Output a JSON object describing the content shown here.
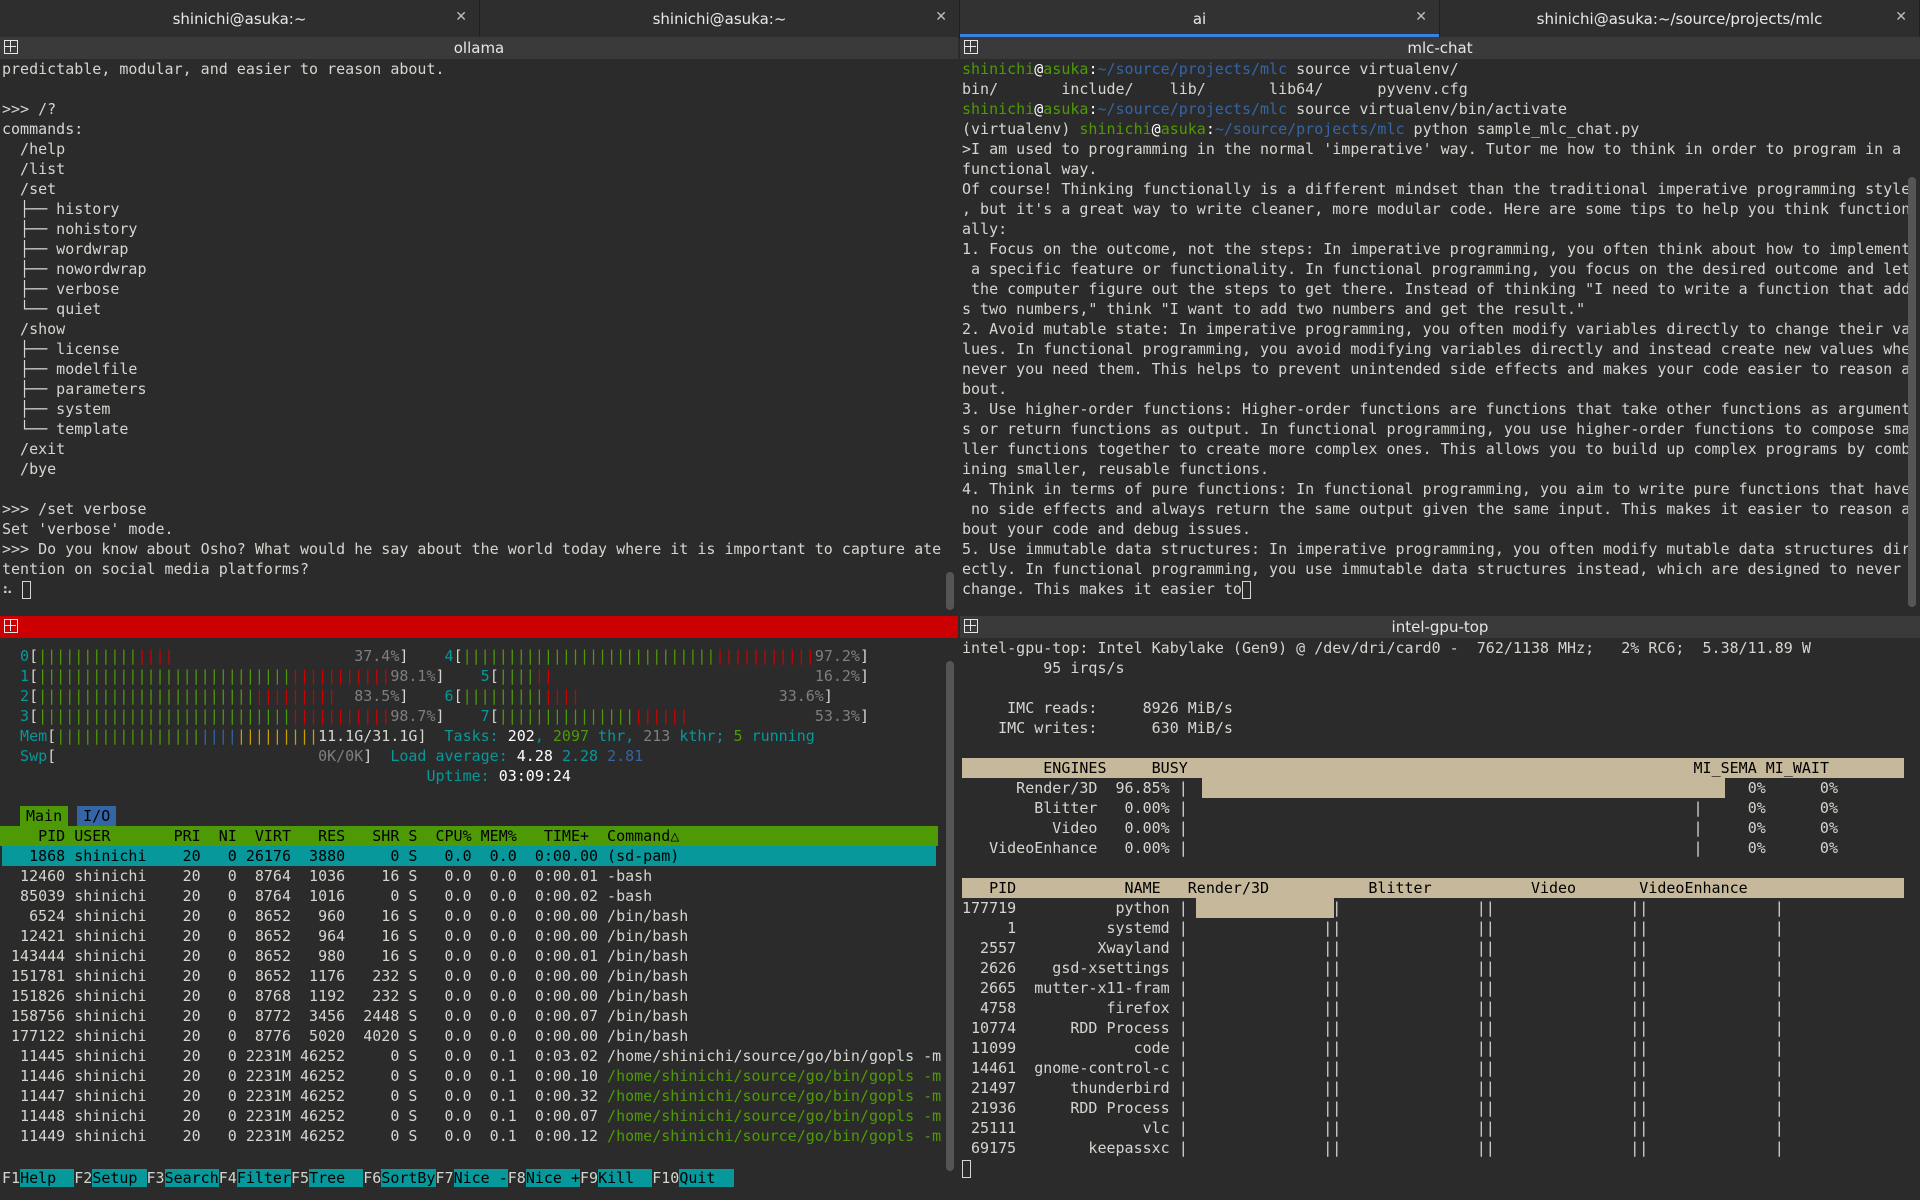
{
  "tabs": [
    {
      "label": "shinichi@asuka:~"
    },
    {
      "label": "shinichi@asuka:~"
    },
    {
      "label": "ai"
    },
    {
      "label": "shinichi@asuka:~/source/projects/mlc"
    }
  ],
  "panes": {
    "ollama": {
      "title": "ollama",
      "lines": [
        "predictable, modular, and easier to reason about.",
        "",
        ">>> /?",
        "commands:",
        "  /help",
        "  /list",
        "  /set",
        "  ├── history",
        "  ├── nohistory",
        "  ├── wordwrap",
        "  ├── nowordwrap",
        "  ├── verbose",
        "  └── quiet",
        "  /show",
        "  ├── license",
        "  ├── modelfile",
        "  ├── parameters",
        "  ├── system",
        "  └── template",
        "  /exit",
        "  /bye",
        "",
        ">>> /set verbose",
        "Set 'verbose' mode.",
        ">>> Do you know about Osho? What would he say about the world today where it is important to capture ate",
        "tention on social media platforms?"
      ],
      "prompt_tail": "⠦ "
    },
    "mlc": {
      "title": "mlc-chat",
      "user": "shinichi",
      "host": "asuka",
      "path": "~/source/projects/mlc",
      "cmd1": " source virtualenv/",
      "ls": "bin/       include/    lib/       lib64/      pyvenv.cfg",
      "cmd2": " source virtualenv/bin/activate",
      "venv": "(virtualenv) ",
      "cmd3": " python sample_mlc_chat.py",
      "lines": [
        ">I am used to programming in the normal 'imperative' way. Tutor me how to think in order to program in a",
        "functional way.",
        "Of course! Thinking functionally is a different mindset than the traditional imperative programming style",
        ", but it's a great way to write cleaner, more modular code. Here are some tips to help you think function",
        "ally:",
        "1. Focus on the outcome, not the steps: In imperative programming, you often think about how to implement",
        " a specific feature or functionality. In functional programming, you focus on the desired outcome and let",
        " the computer figure out the steps to get there. Instead of thinking \"I need to write a function that add",
        "s two numbers,\" think \"I want to add two numbers and get the result.\"",
        "2. Avoid mutable state: In imperative programming, you often modify variables directly to change their va",
        "lues. In functional programming, you avoid modifying variables directly and instead create new values whe",
        "never you need them. This helps to prevent unintended side effects and makes your code easier to reason a",
        "bout.",
        "3. Use higher-order functions: Higher-order functions are functions that take other functions as argument",
        "s or return functions as output. In functional programming, you use higher-order functions to compose sma",
        "ller functions together to create more complex ones. This allows you to build up complex programs by comb",
        "ining smaller, reusable functions.",
        "4. Think in terms of pure functions: In functional programming, you aim to write pure functions that have",
        " no side effects and always return the same output given the same input. This makes it easier to reason a",
        "bout your code and debug issues.",
        "5. Use immutable data structures: In imperative programming, you often modify mutable data structures dir",
        "ectly. In functional programming, you use immutable data structures instead, which are designed to never",
        "change. This makes it easier to"
      ]
    },
    "htop": {
      "title": "htop",
      "cpus": [
        {
          "id": "0",
          "pct": "37.4%",
          "level": 0.374
        },
        {
          "id": "1",
          "pct": "98.1%",
          "level": 0.981
        },
        {
          "id": "2",
          "pct": "83.5%",
          "level": 0.835
        },
        {
          "id": "3",
          "pct": "98.7%",
          "level": 0.987
        },
        {
          "id": "4",
          "pct": "97.2%",
          "level": 0.972
        },
        {
          "id": "5",
          "pct": "16.2%",
          "level": 0.162
        },
        {
          "id": "6",
          "pct": "33.6%",
          "level": 0.336
        },
        {
          "id": "7",
          "pct": "53.3%",
          "level": 0.533
        }
      ],
      "mem": {
        "label": "Mem",
        "val": "11.1G/31.1G"
      },
      "swp": {
        "label": "Swp",
        "val": "0K/0K"
      },
      "tasks_label": "Tasks: ",
      "tasks": "202",
      "thr": "2097",
      "kthr": "213",
      "running": "5",
      "load_label": "Load average: ",
      "load1": "4.28",
      "load5": "2.28",
      "load15": "2.81",
      "uptime_label": "Uptime: ",
      "uptime": "03:09:24",
      "tab_main": "Main",
      "tab_io": "I/O",
      "columns": "    PID USER       PRI  NI  VIRT   RES   SHR S  CPU% MEM%   TIME+  Command△",
      "rows": [
        "   1868 shinichi    20   0 26176  3880     0 S   0.0  0.0  0:00.00 (sd-pam)",
        "  12460 shinichi    20   0  8764  1036    16 S   0.0  0.0  0:00.01 -bash",
        "  85039 shinichi    20   0  8764  1016     0 S   0.0  0.0  0:00.02 -bash",
        "   6524 shinichi    20   0  8652   960    16 S   0.0  0.0  0:00.00 /bin/bash",
        "  12421 shinichi    20   0  8652   964    16 S   0.0  0.0  0:00.00 /bin/bash",
        " 143444 shinichi    20   0  8652   980    16 S   0.0  0.0  0:00.01 /bin/bash",
        " 151781 shinichi    20   0  8652  1176   232 S   0.0  0.0  0:00.00 /bin/bash",
        " 151826 shinichi    20   0  8768  1192   232 S   0.0  0.0  0:00.00 /bin/bash",
        " 158756 shinichi    20   0  8772  3456  2448 S   0.0  0.0  0:00.07 /bin/bash",
        " 177122 shinichi    20   0  8776  5020  4020 S   0.0  0.0  0:00.00 /bin/bash",
        "  11445 shinichi    20   0 2231M 46252     0 S   0.0  0.1  0:03.02 /home/shinichi/source/go/bin/gopls -m",
        "  11446 shinichi    20   0 2231M 46252     0 S   0.0  0.1  0:00.10 /home/shinichi/source/go/bin/gopls -m",
        "  11447 shinichi    20   0 2231M 46252     0 S   0.0  0.1  0:00.32 /home/shinichi/source/go/bin/gopls -m",
        "  11448 shinichi    20   0 2231M 46252     0 S   0.0  0.1  0:00.07 /home/shinichi/source/go/bin/gopls -m",
        "  11449 shinichi    20   0 2231M 46252     0 S   0.0  0.1  0:00.12 /home/shinichi/source/go/bin/gopls -m"
      ],
      "fkeys": [
        {
          "k": "F1",
          "v": "Help  "
        },
        {
          "k": "F2",
          "v": "Setup "
        },
        {
          "k": "F3",
          "v": "Search"
        },
        {
          "k": "F4",
          "v": "Filter"
        },
        {
          "k": "F5",
          "v": "Tree  "
        },
        {
          "k": "F6",
          "v": "SortBy"
        },
        {
          "k": "F7",
          "v": "Nice -"
        },
        {
          "k": "F8",
          "v": "Nice +"
        },
        {
          "k": "F9",
          "v": "Kill  "
        },
        {
          "k": "F10",
          "v": "Quit  "
        }
      ]
    },
    "gpu": {
      "title": "intel-gpu-top",
      "line1": "intel-gpu-top: Intel Kabylake (Gen9) @ /dev/dri/card0 -  762/1138 MHz;   2% RC6;  5.38/11.89 W",
      "line2": "         95 irqs/s",
      "imc_reads": "     IMC reads:     8926 MiB/s",
      "imc_writes": "    IMC writes:      630 MiB/s",
      "eng_header": "         ENGINES     BUSY",
      "eng_tail": "MI_SEMA MI_WAIT",
      "engines": [
        {
          "name": "      Render/3D",
          "busy": "96.85%",
          "level": 0.9685,
          "sema": "0%",
          "wait": "0%"
        },
        {
          "name": "        Blitter",
          "busy": " 0.00%",
          "level": 0,
          "sema": "0%",
          "wait": "0%"
        },
        {
          "name": "          Video",
          "busy": " 0.00%",
          "level": 0,
          "sema": "0%",
          "wait": "0%"
        },
        {
          "name": "   VideoEnhance",
          "busy": " 0.00%",
          "level": 0,
          "sema": "0%",
          "wait": "0%"
        }
      ],
      "client_cols": {
        "pid": "PID",
        "name": "NAME",
        "c1": "Render/3D",
        "c2": "Blitter",
        "c3": "Video",
        "c4": "VideoEnhance"
      },
      "clients": [
        {
          "pid": "177719",
          "name": "python"
        },
        {
          "pid": "1",
          "name": "systemd"
        },
        {
          "pid": "2557",
          "name": "Xwayland"
        },
        {
          "pid": "2626",
          "name": "gsd-xsettings"
        },
        {
          "pid": "2665",
          "name": "mutter-x11-fram"
        },
        {
          "pid": "4758",
          "name": "firefox"
        },
        {
          "pid": "10774",
          "name": "RDD Process"
        },
        {
          "pid": "11099",
          "name": "code"
        },
        {
          "pid": "14461",
          "name": "gnome-control-c"
        },
        {
          "pid": "21497",
          "name": "thunderbird"
        },
        {
          "pid": "21936",
          "name": "RDD Process"
        },
        {
          "pid": "25111",
          "name": "vlc"
        },
        {
          "pid": "69175",
          "name": "keepassxc"
        }
      ],
      "python_render_level": 0.86
    }
  }
}
